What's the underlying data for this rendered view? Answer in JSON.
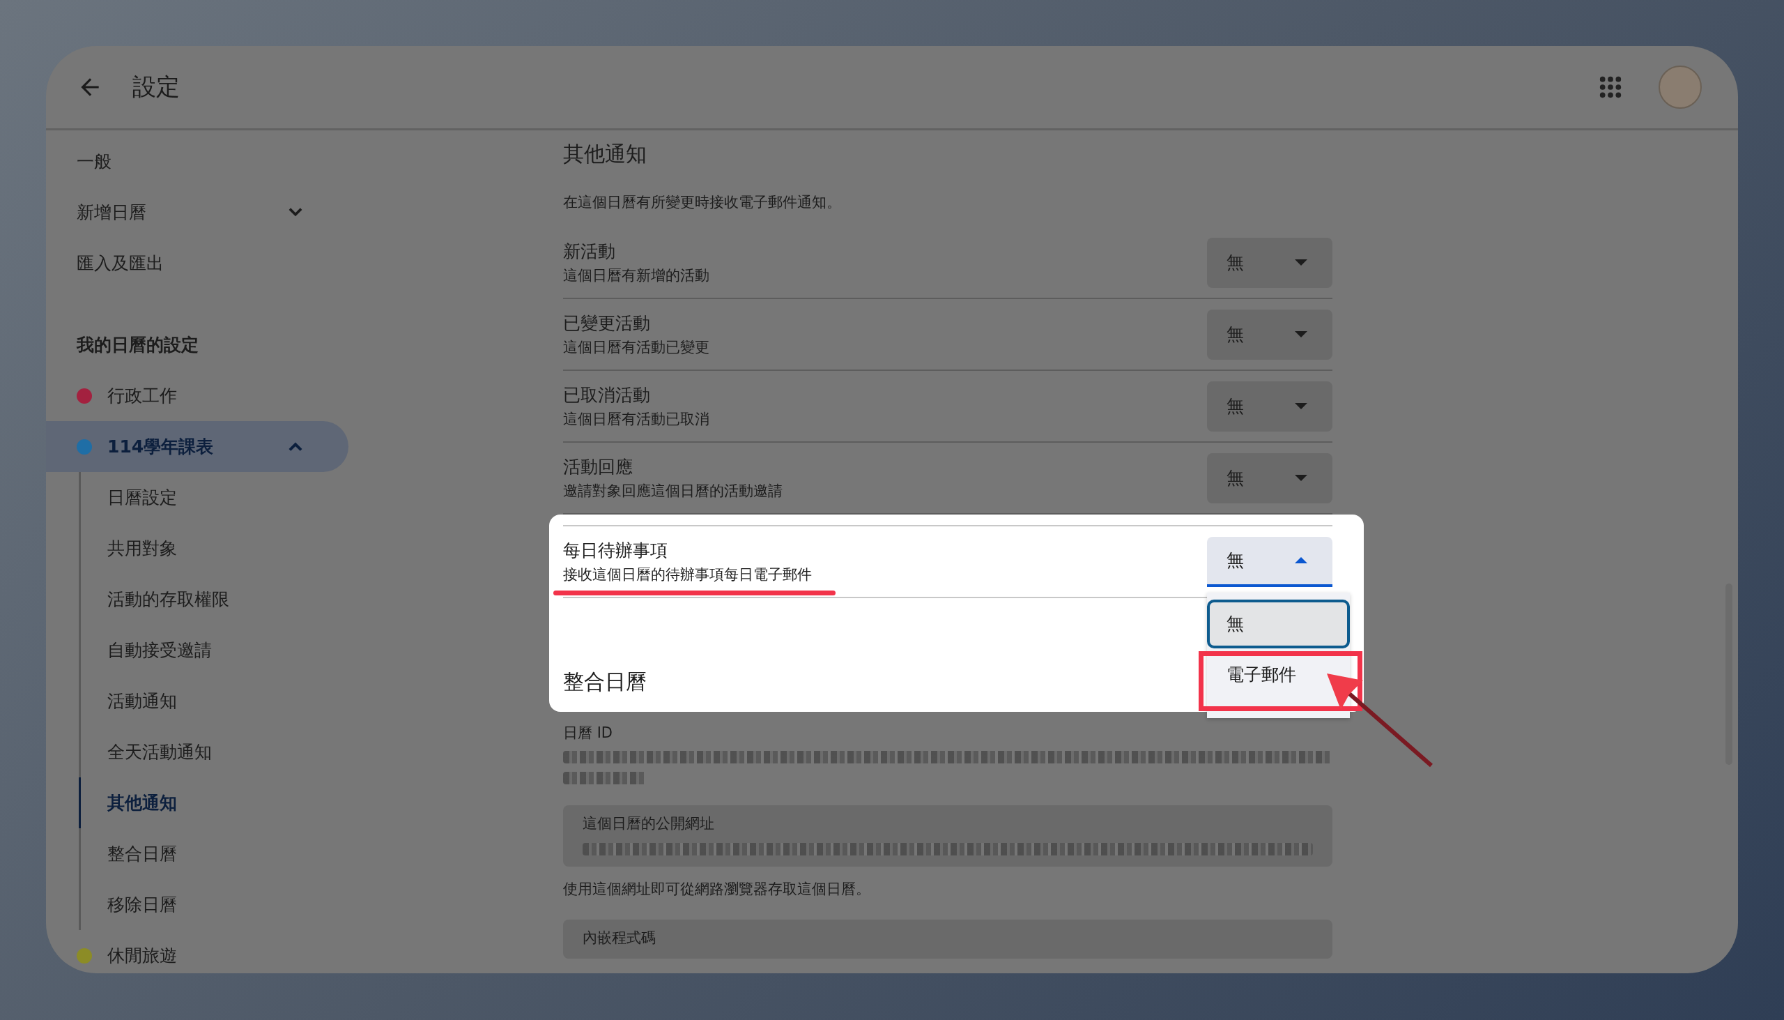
{
  "header": {
    "title": "設定"
  },
  "sidebar": {
    "items": [
      {
        "label": "一般"
      },
      {
        "label": "新增日曆",
        "expanded": false
      },
      {
        "label": "匯入及匯出"
      }
    ],
    "section_title": "我的日曆的設定",
    "calendars": [
      {
        "name": "行政工作",
        "color": "#a3213f",
        "selected": false,
        "expanded": false
      },
      {
        "name": "114學年課表",
        "color": "#1f6ea6",
        "selected": true,
        "expanded": true,
        "children": [
          {
            "label": "日曆設定",
            "selected": false
          },
          {
            "label": "共用對象",
            "selected": false
          },
          {
            "label": "活動的存取權限",
            "selected": false
          },
          {
            "label": "自動接受邀請",
            "selected": false
          },
          {
            "label": "活動通知",
            "selected": false
          },
          {
            "label": "全天活動通知",
            "selected": false
          },
          {
            "label": "其他通知",
            "selected": true
          },
          {
            "label": "整合日曆",
            "selected": false
          },
          {
            "label": "移除日曆",
            "selected": false
          }
        ]
      },
      {
        "name": "休閒旅遊",
        "color": "#8c8c26",
        "selected": false,
        "expanded": false
      }
    ]
  },
  "content": {
    "title": "其他通知",
    "description": "在這個日曆有所變更時接收電子郵件通知。",
    "rows": [
      {
        "title": "新活動",
        "subtitle": "這個日曆有新增的活動",
        "value": "無",
        "open": false
      },
      {
        "title": "已變更活動",
        "subtitle": "這個日曆有活動已變更",
        "value": "無",
        "open": false
      },
      {
        "title": "已取消活動",
        "subtitle": "這個日曆有活動已取消",
        "value": "無",
        "open": false
      },
      {
        "title": "活動回應",
        "subtitle": "邀請對象回應這個日曆的活動邀請",
        "value": "無",
        "open": false
      },
      {
        "title": "每日待辦事項",
        "subtitle": "接收這個日曆的待辦事項每日電子郵件",
        "value": "無",
        "open": true,
        "options": [
          {
            "label": "無",
            "selected": true
          },
          {
            "label": "電子郵件",
            "selected": false
          }
        ]
      }
    ],
    "integration": {
      "title": "整合日曆",
      "calendar_id_label": "日曆 ID",
      "public_url_label": "這個日曆的公開網址",
      "public_url_help": "使用這個網址即可從網路瀏覽器存取這個日曆。",
      "embed_label": "內嵌程式碼"
    }
  }
}
